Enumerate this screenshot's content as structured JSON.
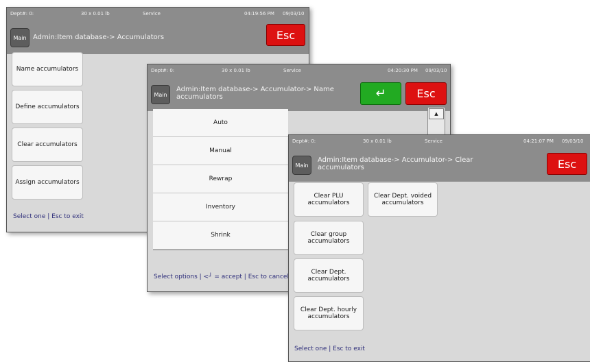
{
  "windows": {
    "accumulators": {
      "status": {
        "dept": "Dept#: 0:",
        "weight": "30 x 0.01 lb",
        "mode": "Service",
        "time": "04:19:56 PM",
        "date": "09/03/10"
      },
      "main_label": "Main",
      "title": "Admin:Item database-> Accumulators",
      "esc_label": "Esc",
      "buttons": [
        "Name accumulators",
        "Define accumulators",
        "Clear accumulators",
        "Assign accumulators"
      ],
      "footer": "Select one | Esc to exit"
    },
    "name_accumulators": {
      "status": {
        "dept": "Dept#: 0:",
        "weight": "30 x 0.01 lb",
        "mode": "Service",
        "time": "04:20:30 PM",
        "date": "09/03/10"
      },
      "main_label": "Main",
      "title": "Admin:Item database-> Accumulator-> Name accumulators",
      "accept_icon": "enter-arrow-icon",
      "accept_label": "↵",
      "esc_label": "Esc",
      "options": [
        "Auto",
        "Manual",
        "Rewrap",
        "Inventory",
        "Shrink"
      ],
      "scroll_icon": "up-arrow-icon",
      "scroll_up_label": "▲",
      "footer": "Select options | <┘ = accept | Esc to cancel"
    },
    "clear_accumulators": {
      "status": {
        "dept": "Dept#: 0:",
        "weight": "30 x 0.01 lb",
        "mode": "Service",
        "time": "04:21:07 PM",
        "date": "09/03/10"
      },
      "main_label": "Main",
      "title": "Admin:Item database-> Accumulator-> Clear accumulators",
      "esc_label": "Esc",
      "buttons": [
        "Clear PLU accumulators",
        "Clear Dept. voided accumulators",
        "Clear group accumulators",
        "Clear Dept. accumulators",
        "Clear Dept. hourly accumulators"
      ],
      "footer": "Select one | Esc to exit"
    }
  },
  "colors": {
    "header_gray": "#8c8c8c",
    "esc_red": "#dd1111",
    "accept_green": "#22aa22",
    "panel_gray": "#d9d9d9"
  }
}
